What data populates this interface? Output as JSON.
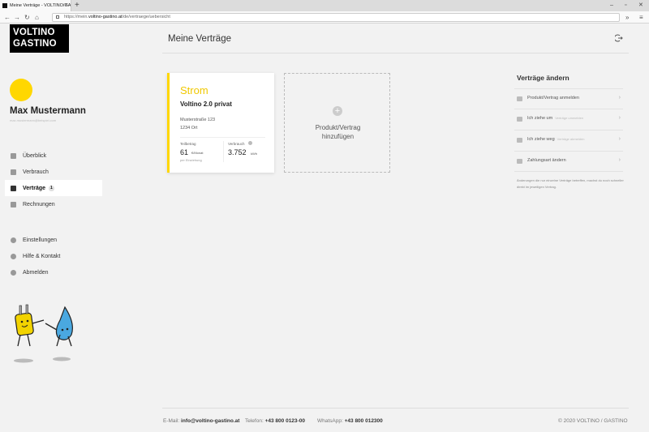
{
  "browser": {
    "tab_title": "Meine Verträge - VOLTINO/GA",
    "url_prefix": "https://mein.",
    "url_domain": "voltino-gastino.at",
    "url_path": "/de/vertraege/uebersicht"
  },
  "brand": {
    "line1": "VOLTINO",
    "line2": "GASTINO",
    "colors": {
      "accent": "#ffd700",
      "logo_bg": "#000000"
    }
  },
  "user": {
    "name": "Max Mustermann",
    "email": "max.mustermann@beispiel.com"
  },
  "nav": {
    "items": [
      {
        "label": "Überblick",
        "icon": "overview-icon"
      },
      {
        "label": "Verbrauch",
        "icon": "bar-chart-icon"
      },
      {
        "label": "Verträge",
        "icon": "contract-icon",
        "badge": "1",
        "active": true
      },
      {
        "label": "Rechnungen",
        "icon": "invoice-icon"
      }
    ],
    "secondary": [
      {
        "label": "Einstellungen",
        "icon": "gear-icon"
      },
      {
        "label": "Hilfe & Kontakt",
        "icon": "help-icon"
      },
      {
        "label": "Abmelden",
        "icon": "logout-icon"
      }
    ]
  },
  "page": {
    "title": "Meine Verträge"
  },
  "contract": {
    "type": "Strom",
    "product": "Voltino 2.0 privat",
    "street": "Musterstraße 123",
    "city": "1234 Ort",
    "partial_label": "Teilbetrag",
    "partial_value": "61",
    "partial_unit": "€/Monat",
    "partial_note": "per Einziehung",
    "usage_label": "Verbrauch",
    "usage_value": "3.752",
    "usage_unit": "kWh"
  },
  "add_card": {
    "line1": "Produkt/Vertrag",
    "line2": "hinzufügen"
  },
  "actions": {
    "title": "Verträge ändern",
    "items": [
      {
        "label": "Produkt/Vertrag anmelden",
        "sub": "",
        "icon": "tag-icon"
      },
      {
        "label": "Ich ziehe um",
        "sub": "Verträge ummelden",
        "icon": "truck-icon"
      },
      {
        "label": "Ich ziehe weg",
        "sub": "Verträge abmelden",
        "icon": "door-icon"
      },
      {
        "label": "Zahlungsart ändern",
        "sub": "",
        "icon": "credit-card-icon"
      }
    ],
    "note": "Änderungen die nur einzelne Verträge betreffen, machst du noch schneller direkt im jeweiligen Vertrag."
  },
  "footer": {
    "email_label": "E-Mail:",
    "email": "info@voltino-gastino.at",
    "phone_label": "Telefon:",
    "phone": "+43 800 0123-00",
    "whatsapp_label": "WhatsApp:",
    "whatsapp": "+43 800 012300",
    "copyright": "© 2020 VOLTINO / GASTINO"
  }
}
